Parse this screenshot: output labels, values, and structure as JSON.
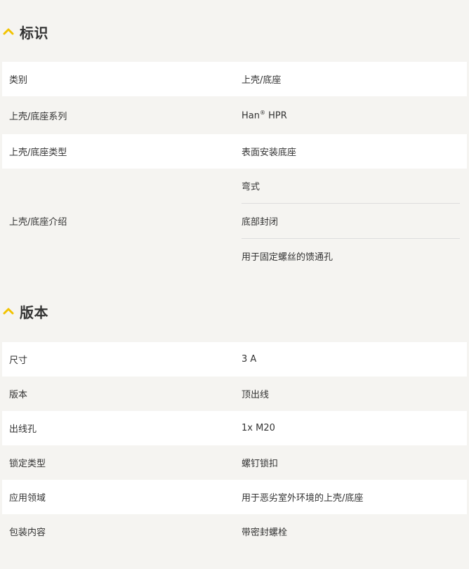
{
  "colors": {
    "accent": "#f2c300",
    "background": "#f5f4f1",
    "row_white": "#ffffff"
  },
  "section_identification": {
    "title": "标识",
    "icon": "chevron-up-icon",
    "rows": [
      {
        "key": "类别",
        "value": "上壳/底座"
      },
      {
        "key": "上壳/底座系列",
        "value_main": "Han",
        "value_sup": "®",
        "value_rest": " HPR"
      },
      {
        "key": "上壳/底座类型",
        "value": "表面安装底座"
      },
      {
        "key": "上壳/底座介绍",
        "values": [
          "弯式",
          "底部封闭",
          "用于固定螺丝的馈通孔"
        ]
      }
    ]
  },
  "section_version": {
    "title": "版本",
    "icon": "chevron-up-icon",
    "rows": [
      {
        "key": "尺寸",
        "value": "3 A"
      },
      {
        "key": "版本",
        "value": "顶出线"
      },
      {
        "key": "出线孔",
        "value": "1x M20"
      },
      {
        "key": "锁定类型",
        "value": "螺钉锁扣"
      },
      {
        "key": "应用领域",
        "value": "用于恶劣室外环境的上壳/底座"
      },
      {
        "key": "包装内容",
        "value": "带密封螺栓"
      }
    ]
  }
}
